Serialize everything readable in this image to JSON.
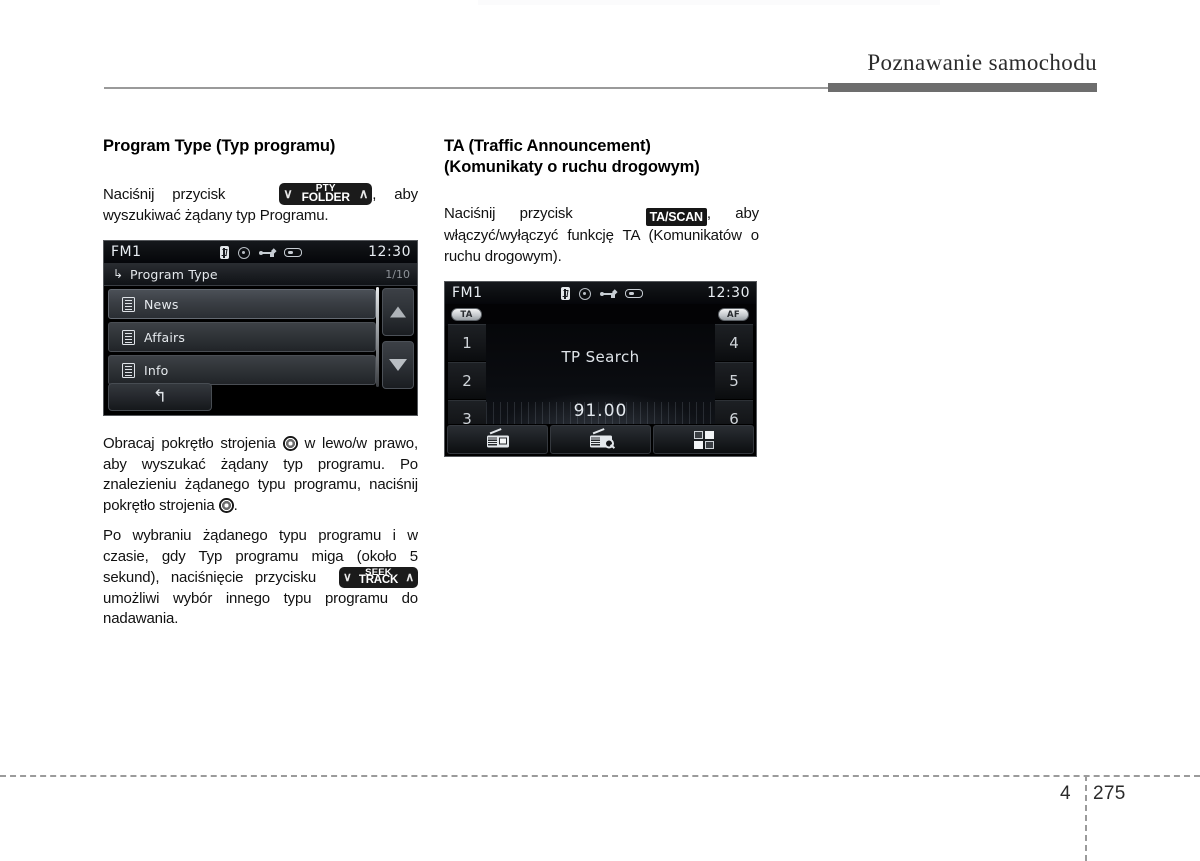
{
  "header": {
    "running_title": "Poznawanie samochodu"
  },
  "footer": {
    "chapter": "4",
    "page": "275"
  },
  "left_column": {
    "section_title": "Program Type (Typ programu)",
    "para1_before": "Naciśnij przycisk",
    "key_pty": {
      "line1": "PTY",
      "line2": "FOLDER",
      "left_chevron": "∨",
      "right_chevron": "∧"
    },
    "para1_after": ", aby wyszukiwać żądany typ Programu.",
    "para2": "Obracaj pokrętło strojenia",
    "para2_mid": "w lewo/w prawo, aby wyszukać żądany typ programu. Po znalezieniu żądanego typu programu, naciśnij pokrętło strojenia",
    "para2_end": ".",
    "para3_before": "Po wybraniu żądanego typu programu i w czasie, gdy Typ programu miga (około 5 sekund), naciśnięcie przycisku",
    "key_seek": {
      "line1": "SEEK",
      "line2": "TRACK",
      "left_chevron": "∨",
      "right_chevron": "∧"
    },
    "para3_after": "umożliwi wybór innego typu programu do nadawania."
  },
  "right_column": {
    "section_title_line1": "TA (Traffic Announcement)",
    "section_title_line2": "(Komunikaty o ruchu drogowym)",
    "para1_before": "Naciśnij przycisk",
    "key_tascan": "TA/SCAN",
    "para1_after": ", aby włączyć/wyłączyć funkcję TA (Komunikatów o ruchu drogowym)."
  },
  "screen_program_type": {
    "status": {
      "source": "FM1",
      "clock": "12:30",
      "icons": [
        "bluetooth-icon",
        "disc-icon",
        "usb-icon",
        "device-icon"
      ]
    },
    "list_header": {
      "back_arrow": "↳",
      "title": "Program Type",
      "count": "1/10"
    },
    "items": [
      {
        "label": "News",
        "selected": true
      },
      {
        "label": "Affairs",
        "selected": false
      },
      {
        "label": "Info",
        "selected": false
      }
    ],
    "scroll_up": "▲",
    "scroll_down": "▼",
    "back_button": "↰"
  },
  "screen_tp_search": {
    "status": {
      "source": "FM1",
      "clock": "12:30",
      "icons": [
        "bluetooth-icon",
        "disc-icon",
        "usb-icon",
        "device-icon"
      ]
    },
    "tags": {
      "ta": "TA",
      "af": "AF"
    },
    "presets_left": [
      "1",
      "2",
      "3"
    ],
    "presets_right": [
      "4",
      "5",
      "6"
    ],
    "status_text": "TP Search",
    "frequency": "91.00",
    "bottom_buttons": [
      "radio-icon",
      "radio-scan-icon",
      "grid-menu-icon"
    ]
  },
  "colors": {
    "header_rule_thick": "#6d6d6d",
    "header_rule_thin": "#9a9a9a",
    "screen_bg": "#000000",
    "key_bg": "#1b1b1b"
  }
}
